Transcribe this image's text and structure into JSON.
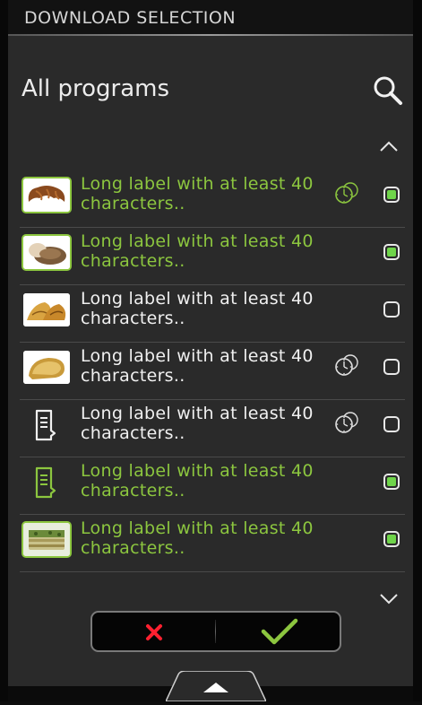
{
  "header": {
    "title": "DOWNLOAD SELECTION"
  },
  "page": {
    "heading": "All programs"
  },
  "icons": {
    "search": "search-icon",
    "scroll_up": "chevron-up-icon",
    "scroll_down": "chevron-down-icon",
    "cancel": "close-icon",
    "confirm": "check-icon",
    "drawer": "triangle-up-icon"
  },
  "colors": {
    "selected_text": "#8cc63f",
    "unselected_text": "#f0f0f0",
    "checkbox_fill": "#6fd44a",
    "cancel_icon": "#ff2030",
    "confirm_icon": "#8cc63f",
    "background": "#2a2a2a"
  },
  "programs": [
    {
      "label": "Long label with at least 40 characters..",
      "image": "croissant",
      "timer": true,
      "selected": true
    },
    {
      "label": "Long label with at least 40 characters..",
      "image": "bread-roll",
      "timer": false,
      "selected": true
    },
    {
      "label": "Long label with at least 40 characters..",
      "image": "croissants-pair",
      "timer": false,
      "selected": false
    },
    {
      "label": "Long label with at least 40 characters..",
      "image": "toast",
      "timer": true,
      "selected": false
    },
    {
      "label": "Long label with at least 40 characters..",
      "image": "document",
      "timer": true,
      "selected": false
    },
    {
      "label": "Long label with at least 40 characters..",
      "image": "document",
      "timer": false,
      "selected": true
    },
    {
      "label": "Long label with at least 40 characters..",
      "image": "lasagna",
      "timer": false,
      "selected": true
    }
  ]
}
